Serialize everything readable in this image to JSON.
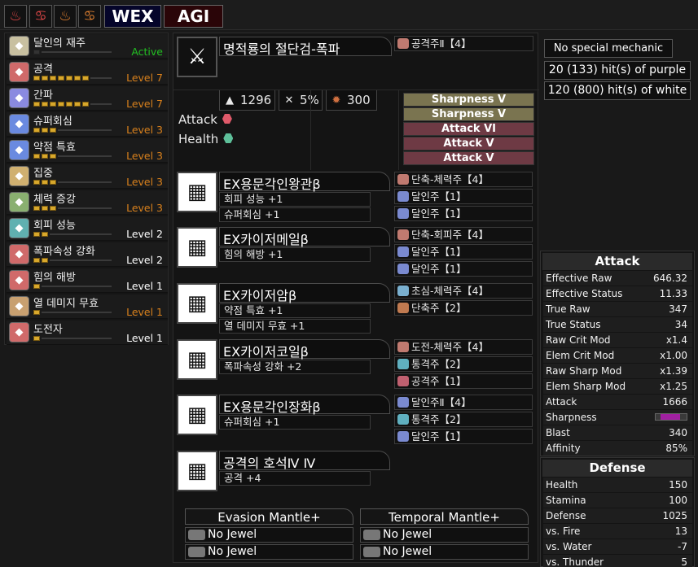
{
  "topbar": {
    "icons": [
      "monster-icon-1",
      "monster-icon-2",
      "monster-icon-3",
      "monster-icon-4"
    ],
    "wex_label": "WEX",
    "agi_label": "AGI"
  },
  "skills": [
    {
      "name": "달인의 재주",
      "level": "Active",
      "pips": 0,
      "color": "#22c022",
      "icon": "expert-icon",
      "icolor": "#c8c0a0"
    },
    {
      "name": "공격",
      "level": "Level 7",
      "pips": 7,
      "color": "#d8801c",
      "icon": "attack-icon",
      "icolor": "#d06a6a"
    },
    {
      "name": "간파",
      "level": "Level 7",
      "pips": 7,
      "color": "#d8801c",
      "icon": "crit-eye-icon",
      "icolor": "#8a8ae0"
    },
    {
      "name": "슈퍼회심",
      "level": "Level 3",
      "pips": 3,
      "color": "#d8801c",
      "icon": "crit-boost-icon",
      "icolor": "#6a8ae0"
    },
    {
      "name": "약점 특효",
      "level": "Level 3",
      "pips": 3,
      "color": "#d8801c",
      "icon": "weakness-icon",
      "icolor": "#6a8ae0"
    },
    {
      "name": "집중",
      "level": "Level 3",
      "pips": 3,
      "color": "#d8801c",
      "icon": "focus-icon",
      "icolor": "#d0b070"
    },
    {
      "name": "체력 증강",
      "level": "Level 3",
      "pips": 3,
      "color": "#d8801c",
      "icon": "health-icon",
      "icolor": "#8ab070"
    },
    {
      "name": "회피 성능",
      "level": "Level 2",
      "pips": 2,
      "color": "#ffffff",
      "icon": "evade-icon",
      "icolor": "#60b0b0"
    },
    {
      "name": "폭파속성 강화",
      "level": "Level 2",
      "pips": 2,
      "color": "#ffffff",
      "icon": "blast-icon",
      "icolor": "#d06a6a"
    },
    {
      "name": "힘의 해방",
      "level": "Level 1",
      "pips": 1,
      "color": "#ffffff",
      "icon": "latent-power-icon",
      "icolor": "#d06a6a"
    },
    {
      "name": "열 데미지 무효",
      "level": "Level 1",
      "pips": 1,
      "color": "#d8801c",
      "icon": "heat-guard-icon",
      "icolor": "#c8a070"
    },
    {
      "name": "도전자",
      "level": "Level 1",
      "pips": 1,
      "color": "#ffffff",
      "icon": "agitator-icon",
      "icolor": "#d06a6a"
    }
  ],
  "weapon": {
    "name": "명적룡의 절단검-폭파",
    "attack": "1296",
    "affinity": "5%",
    "element": "300",
    "deco": "공격주Ⅱ【4】",
    "mods": [
      {
        "label": "Attack",
        "color": "#e05a6a"
      },
      {
        "label": "Health",
        "color": "#5ec09a"
      }
    ],
    "bonuses": [
      {
        "label": "Sharpness V",
        "color": "#7a7450"
      },
      {
        "label": "Sharpness V",
        "color": "#7a7450"
      },
      {
        "label": "Attack VI",
        "color": "#6e3a44"
      },
      {
        "label": "Attack V",
        "color": "#6e3a44"
      },
      {
        "label": "Attack V",
        "color": "#6e3a44"
      }
    ]
  },
  "armor": [
    {
      "name": "EX용문각인왕관β",
      "skills": [
        "회피 성능 +1",
        "슈퍼회심 +1"
      ],
      "decos": [
        {
          "label": "단축-체력주【4】",
          "c": "#c07a70"
        },
        {
          "label": "달인주【1】",
          "c": "#7a8ad0"
        },
        {
          "label": "달인주【1】",
          "c": "#7a8ad0"
        }
      ],
      "icon": "helm-icon"
    },
    {
      "name": "EX카이저메일β",
      "skills": [
        "힘의 해방 +1"
      ],
      "decos": [
        {
          "label": "단축-회피주【4】",
          "c": "#c07a70"
        },
        {
          "label": "달인주【1】",
          "c": "#7a8ad0"
        },
        {
          "label": "달인주【1】",
          "c": "#7a8ad0"
        }
      ],
      "icon": "chest-icon"
    },
    {
      "name": "EX카이저암β",
      "skills": [
        "약점 특효 +1",
        "열 데미지 무효 +1"
      ],
      "decos": [
        {
          "label": "초심-체력주【4】",
          "c": "#7ab0d0"
        },
        {
          "label": "단축주【2】",
          "c": "#c07a50"
        }
      ],
      "icon": "arms-icon"
    },
    {
      "name": "EX카이저코일β",
      "skills": [
        "폭파속성 강화 +2"
      ],
      "decos": [
        {
          "label": "도전-체력주【4】",
          "c": "#c07a70"
        },
        {
          "label": "통격주【2】",
          "c": "#60b0c0"
        },
        {
          "label": "공격주【1】",
          "c": "#c06070"
        }
      ],
      "icon": "waist-icon"
    },
    {
      "name": "EX용문각인장화β",
      "skills": [
        "슈퍼회심 +1"
      ],
      "decos": [
        {
          "label": "달인주Ⅱ【4】",
          "c": "#7a8ad0"
        },
        {
          "label": "통격주【2】",
          "c": "#60b0c0"
        },
        {
          "label": "달인주【1】",
          "c": "#7a8ad0"
        }
      ],
      "icon": "legs-icon"
    },
    {
      "name": "공격의 호석Ⅳ Ⅳ",
      "skills": [
        "공격 +4"
      ],
      "decos": [],
      "icon": "charm-icon"
    }
  ],
  "mantles": [
    {
      "name": "Evasion Mantle+",
      "jewels": [
        "No Jewel",
        "No Jewel"
      ]
    },
    {
      "name": "Temporal Mantle+",
      "jewels": [
        "No Jewel",
        "No Jewel"
      ]
    }
  ],
  "info": {
    "mechanic": "No special mechanic",
    "purple": "20 (133) hit(s) of purple",
    "white": "120 (800) hit(s) of white"
  },
  "attack": {
    "title": "Attack",
    "rows": [
      {
        "label": "Effective Raw",
        "value": "646.32"
      },
      {
        "label": "Effective Status",
        "value": "11.33"
      },
      {
        "label": "True Raw",
        "value": "347"
      },
      {
        "label": "True Status",
        "value": "34"
      },
      {
        "label": "Raw Crit Mod",
        "value": "x1.4"
      },
      {
        "label": "Elem Crit Mod",
        "value": "x1.00"
      },
      {
        "label": "Raw Sharp Mod",
        "value": "x1.39"
      },
      {
        "label": "Elem Sharp Mod",
        "value": "x1.25"
      },
      {
        "label": "Attack",
        "value": "1666"
      },
      {
        "label": "Sharpness",
        "value": ""
      },
      {
        "label": "Blast",
        "value": "340"
      },
      {
        "label": "Affinity",
        "value": "85%"
      }
    ]
  },
  "defense": {
    "title": "Defense",
    "rows": [
      {
        "label": "Health",
        "value": "150"
      },
      {
        "label": "Stamina",
        "value": "100"
      },
      {
        "label": "Defense",
        "value": "1025"
      },
      {
        "label": "vs. Fire",
        "value": "13"
      },
      {
        "label": "vs. Water",
        "value": "-7"
      },
      {
        "label": "vs. Thunder",
        "value": "5"
      }
    ]
  }
}
